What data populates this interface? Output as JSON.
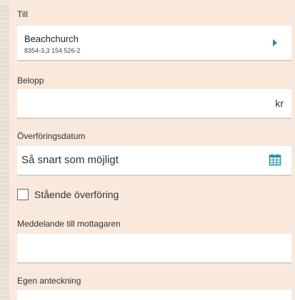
{
  "form": {
    "recipient": {
      "label": "Till",
      "name": "Beachchurch",
      "account": "8354-3,3 154 526-2"
    },
    "amount": {
      "label": "Belopp",
      "unit": "kr"
    },
    "date": {
      "label": "Överföringsdatum",
      "value": "Så snart som möjligt"
    },
    "recurring": {
      "label": "Stående överföring",
      "checked": false
    },
    "message": {
      "label": "Meddelande till mottagaren"
    },
    "note": {
      "label": "Egen anteckning"
    }
  },
  "colors": {
    "accent": "#2a8fa2",
    "background": "#f8e9dc"
  }
}
